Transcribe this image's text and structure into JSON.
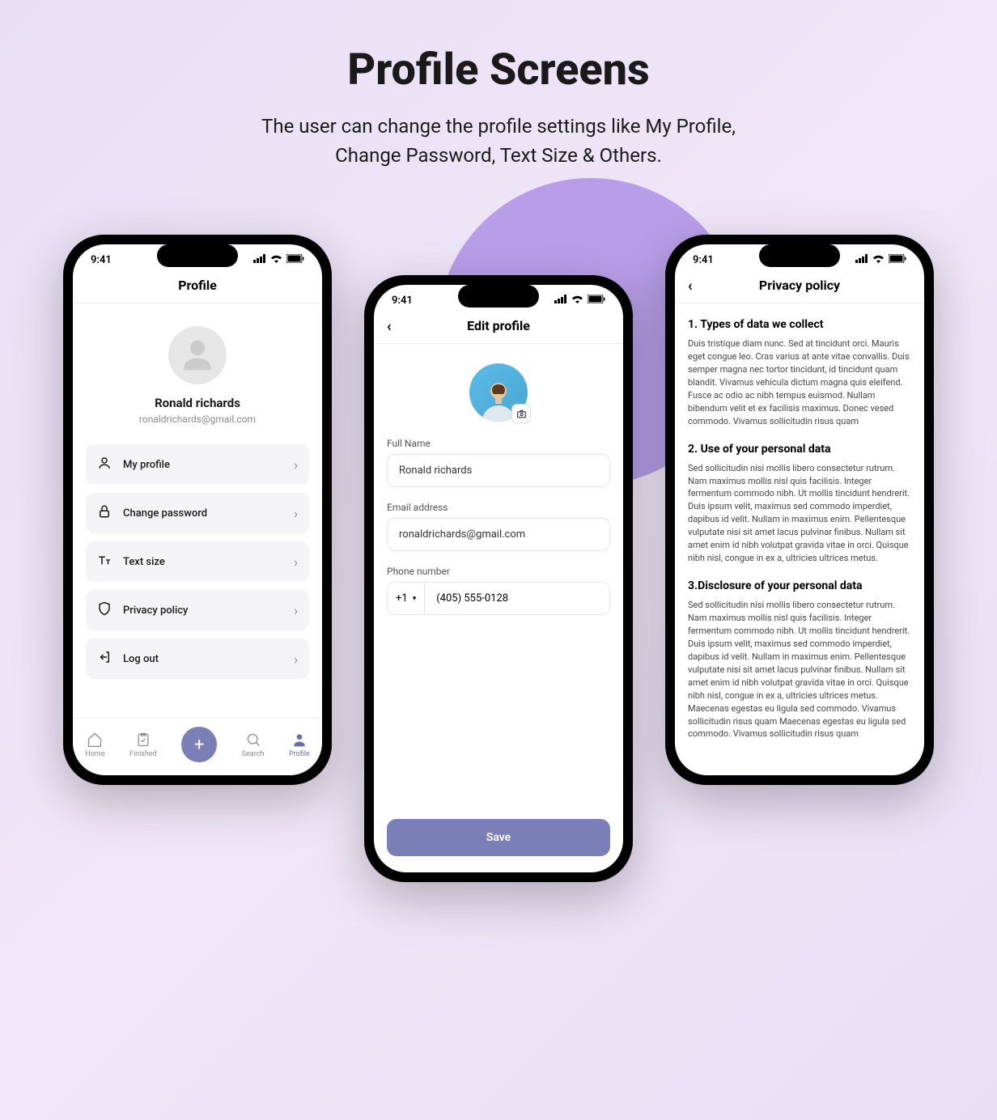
{
  "hero": {
    "title": "Profile Screens",
    "line1": "The user can change the profile settings like My Profile,",
    "line2": "Change Password, Text Size & Others."
  },
  "status": {
    "time": "9:41"
  },
  "phone1": {
    "title": "Profile",
    "user": {
      "name": "Ronald richards",
      "email": "ronaldrichards@gmail.com"
    },
    "menu": {
      "my_profile": "My profile",
      "change_password": "Change password",
      "text_size": "Text size",
      "privacy_policy": "Privacy policy",
      "logout": "Log out"
    },
    "tabs": {
      "home": "Home",
      "finished": "Finished",
      "search": "Search",
      "profile": "Profile"
    }
  },
  "phone2": {
    "title": "Edit profile",
    "labels": {
      "fullname": "Full Name",
      "email": "Email address",
      "phone": "Phone number"
    },
    "values": {
      "fullname": "Ronald richards",
      "email": "ronaldrichards@gmail.com",
      "cc": "+1",
      "phone": "(405) 555-0128"
    },
    "save": "Save"
  },
  "phone3": {
    "title": "Privacy policy",
    "s1": {
      "h": "1. Types of data we collect",
      "p": "Duis tristique diam nunc. Sed at tincidunt orci. Mauris eget congue leo. Cras varius at ante vitae convallis. Duis semper magna nec tortor tincidunt, id tincidunt quam blandit. Vivamus vehicula dictum magna quis eleifend. Fusce ac odio ac nibh tempus euismod. Nullam bibendum velit et ex facilisis maximus. Donec vesed commodo. Vivamus sollicitudin risus quam"
    },
    "s2": {
      "h": "2. Use of your personal data",
      "p": "Sed sollicitudin nisi mollis libero consectetur rutrum. Nam maximus mollis nisl quis facilisis. Integer fermentum commodo nibh. Ut mollis tincidunt hendrerit. Duis ipsum velit, maximus sed commodo imperdiet, dapibus id velit. Nullam in maximus enim. Pellentesque vulputate nisi sit amet lacus pulvinar finibus. Nullam sit amet enim id nibh volutpat gravida vitae in orci. Quisque nibh nisl, congue in ex a, ultricies ultrices metus."
    },
    "s3": {
      "h": "3.Disclosure of your personal data",
      "p": "Sed sollicitudin nisi mollis libero consectetur rutrum. Nam maximus mollis nisl quis facilisis. Integer fermentum commodo nibh. Ut mollis tincidunt hendrerit. Duis ipsum velit, maximus sed commodo imperdiet, dapibus id velit. Nullam in maximus enim. Pellentesque vulputate nisi sit amet lacus pulvinar finibus. Nullam sit amet enim id nibh volutpat gravida vitae in orci. Quisque nibh nisl, congue in ex a, ultricies ultrices metus. Maecenas egestas eu ligula sed commodo. Vivamus sollicitudin risus quam Maecenas egestas eu ligula sed commodo. Vivamus sollicitudin risus quam"
    }
  }
}
